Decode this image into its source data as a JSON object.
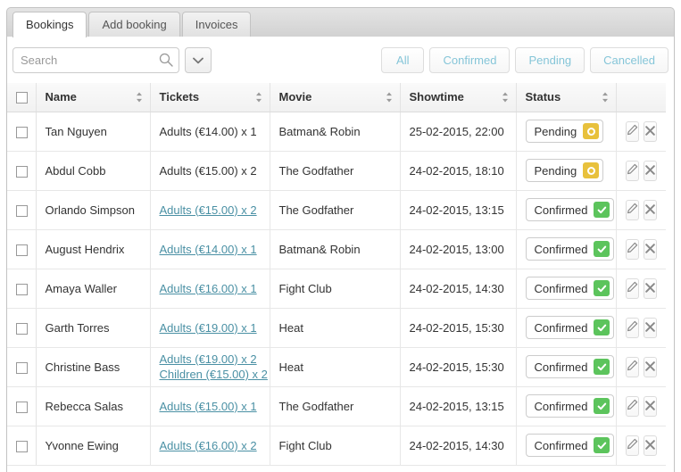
{
  "tabs": [
    {
      "label": "Bookings",
      "active": true
    },
    {
      "label": "Add booking",
      "active": false
    },
    {
      "label": "Invoices",
      "active": false
    }
  ],
  "toolbar": {
    "search_placeholder": "Search",
    "search_value": "",
    "dropdown_icon": "chevron-down-icon",
    "search_icon": "search-icon",
    "filters": [
      {
        "label": "All"
      },
      {
        "label": "Confirmed"
      },
      {
        "label": "Pending"
      },
      {
        "label": "Cancelled"
      }
    ]
  },
  "table": {
    "columns": [
      {
        "label": "Name",
        "sortable": true
      },
      {
        "label": "Tickets",
        "sortable": true
      },
      {
        "label": "Movie",
        "sortable": true
      },
      {
        "label": "Showtime",
        "sortable": true
      },
      {
        "label": "Status",
        "sortable": true
      }
    ],
    "select_all_checked": false,
    "rows": [
      {
        "name": "Tan Nguyen",
        "tickets": [
          {
            "text": "Adults (€14.00) x 1",
            "link": false
          }
        ],
        "movie": "Batman& Robin",
        "showtime": "25-02-2015, 22:00",
        "status": "Pending",
        "status_type": "pending"
      },
      {
        "name": "Abdul Cobb",
        "tickets": [
          {
            "text": "Adults (€15.00) x 2",
            "link": false
          }
        ],
        "movie": "The Godfather",
        "showtime": "24-02-2015, 18:10",
        "status": "Pending",
        "status_type": "pending"
      },
      {
        "name": "Orlando Simpson",
        "tickets": [
          {
            "text": "Adults (€15.00) x 2",
            "link": true
          }
        ],
        "movie": "The Godfather",
        "showtime": "24-02-2015, 13:15",
        "status": "Confirmed",
        "status_type": "confirmed"
      },
      {
        "name": "August Hendrix",
        "tickets": [
          {
            "text": "Adults (€14.00) x 1",
            "link": true
          }
        ],
        "movie": "Batman& Robin",
        "showtime": "24-02-2015, 13:00",
        "status": "Confirmed",
        "status_type": "confirmed"
      },
      {
        "name": "Amaya Waller",
        "tickets": [
          {
            "text": "Adults (€16.00) x 1",
            "link": true
          }
        ],
        "movie": "Fight Club",
        "showtime": "24-02-2015, 14:30",
        "status": "Confirmed",
        "status_type": "confirmed"
      },
      {
        "name": "Garth Torres",
        "tickets": [
          {
            "text": "Adults (€19.00) x 1",
            "link": true
          }
        ],
        "movie": "Heat",
        "showtime": "24-02-2015, 15:30",
        "status": "Confirmed",
        "status_type": "confirmed"
      },
      {
        "name": "Christine Bass",
        "tickets": [
          {
            "text": "Adults (€19.00) x 2",
            "link": true
          },
          {
            "text": "Children (€15.00) x 2",
            "link": true
          }
        ],
        "movie": "Heat",
        "showtime": "24-02-2015, 15:30",
        "status": "Confirmed",
        "status_type": "confirmed"
      },
      {
        "name": "Rebecca Salas",
        "tickets": [
          {
            "text": "Adults (€15.00) x 1",
            "link": true
          }
        ],
        "movie": "The Godfather",
        "showtime": "24-02-2015, 13:15",
        "status": "Confirmed",
        "status_type": "confirmed"
      },
      {
        "name": "Yvonne Ewing",
        "tickets": [
          {
            "text": "Adults (€16.00) x 2",
            "link": true
          }
        ],
        "movie": "Fight Club",
        "showtime": "24-02-2015, 14:30",
        "status": "Confirmed",
        "status_type": "confirmed"
      }
    ],
    "row_actions": [
      {
        "name": "edit-button",
        "icon": "pencil-icon"
      },
      {
        "name": "delete-button",
        "icon": "close-icon"
      }
    ]
  },
  "colors": {
    "filter_text": "#85c5d8",
    "link": "#4a90a4",
    "pending_badge": "#e8c13c",
    "confirmed_badge": "#5cc45c"
  }
}
